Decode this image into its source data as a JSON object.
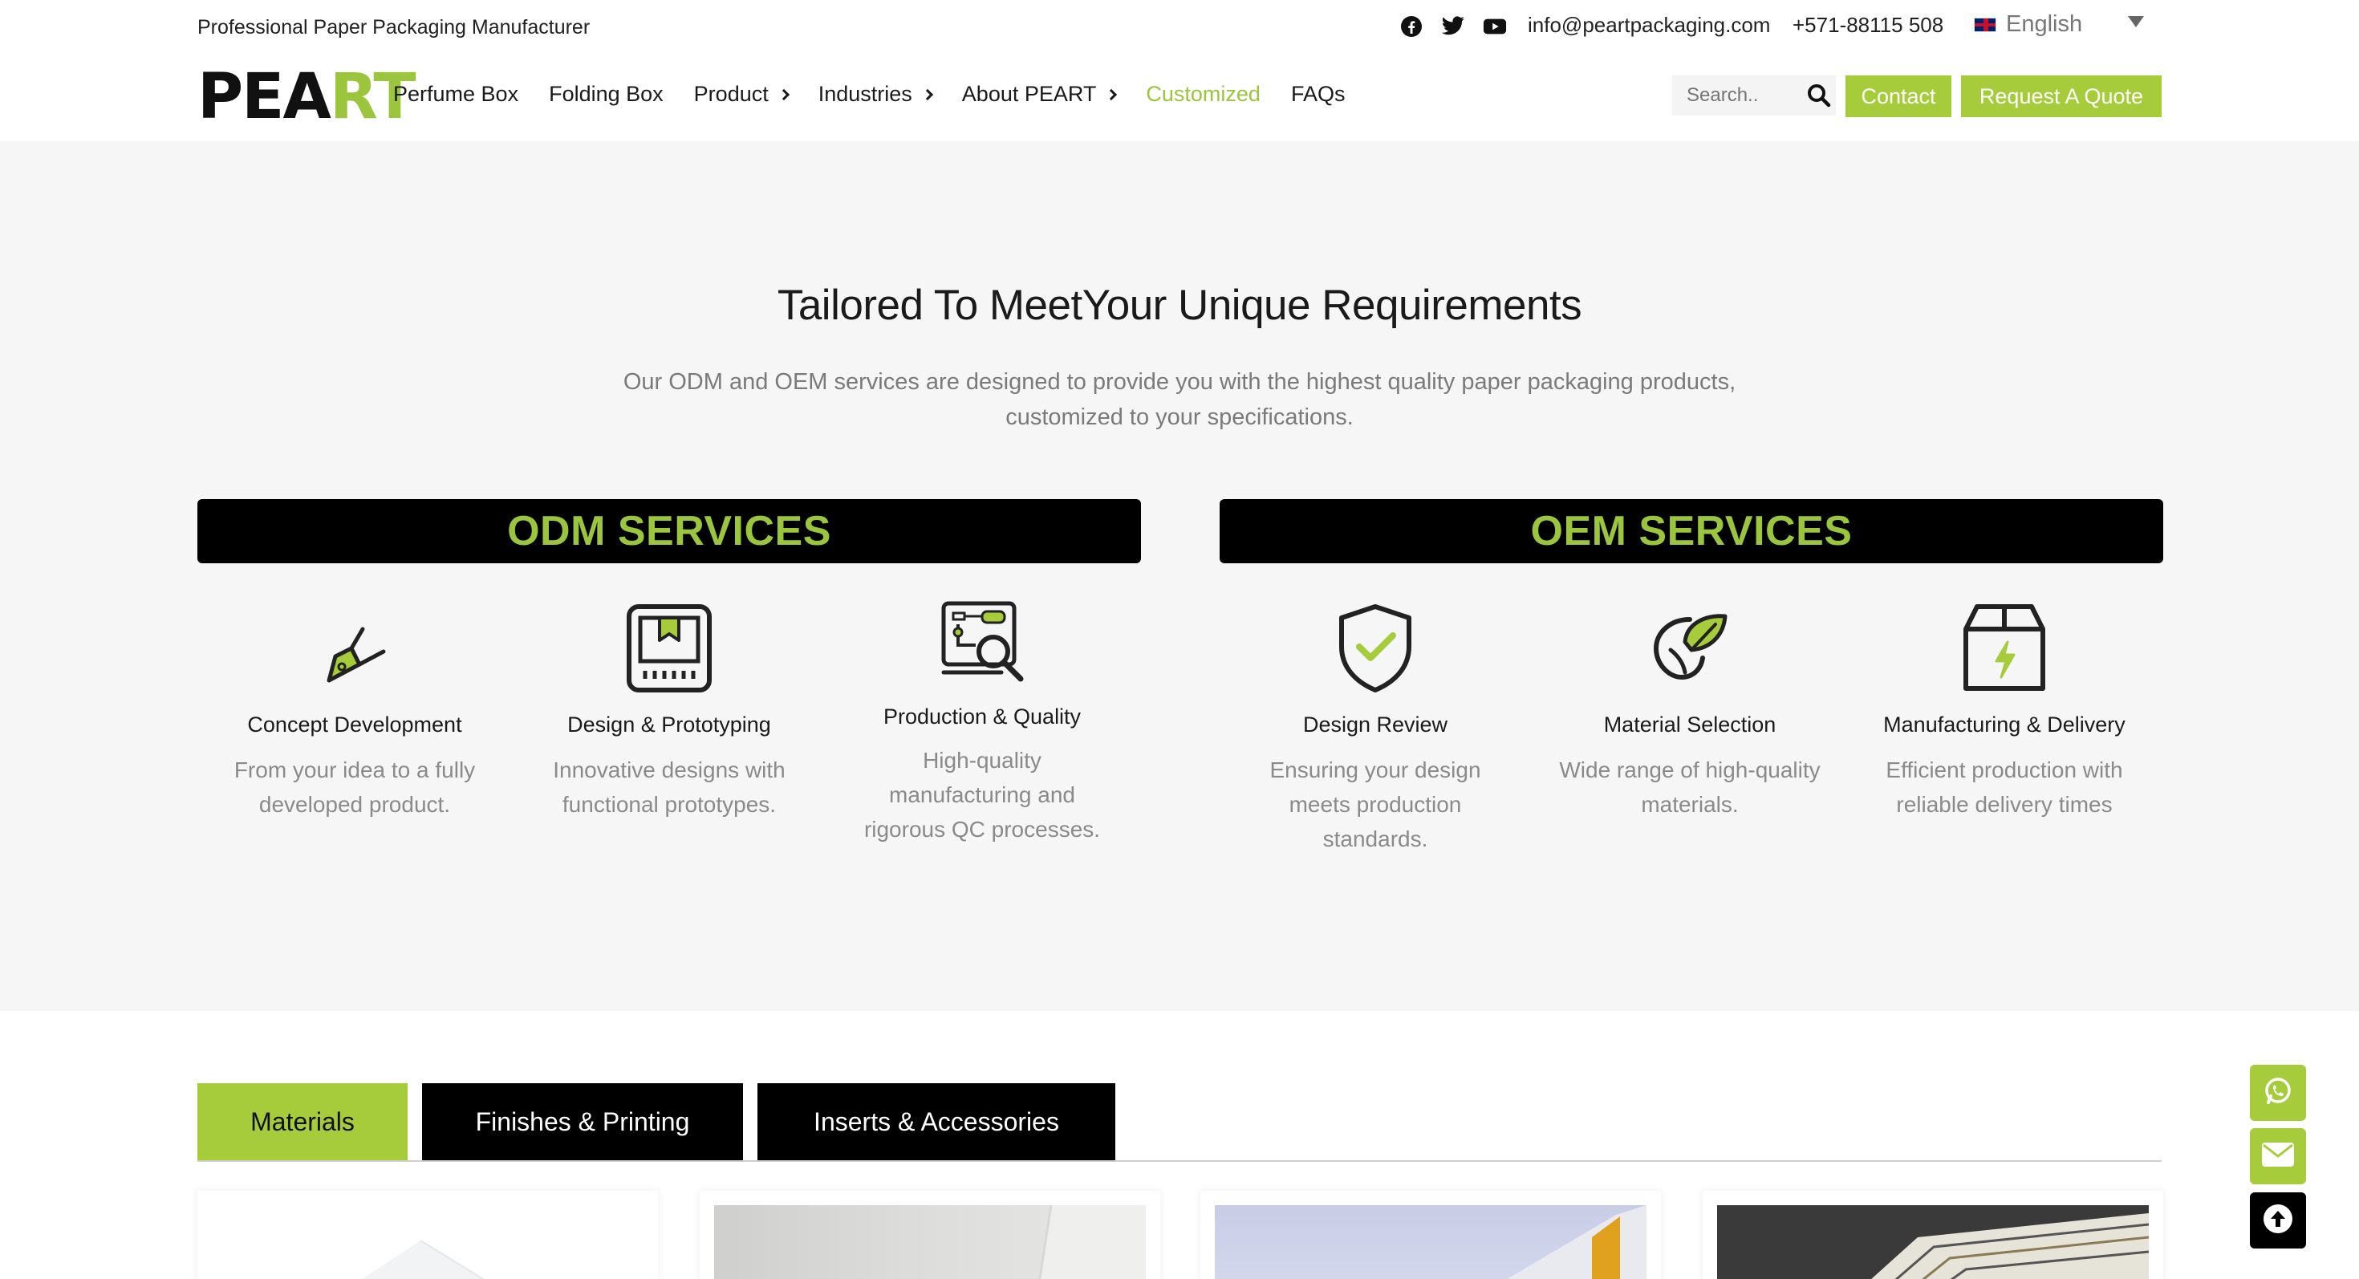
{
  "topbar": {
    "tagline": "Professional Paper Packaging Manufacturer",
    "social_icons": [
      "facebook-icon",
      "twitter-icon",
      "youtube-icon"
    ],
    "email": "info@peartpackaging.com",
    "phone": "+571-88115 508",
    "language": "English"
  },
  "logo": {
    "part1": "PEA",
    "part2": "RT"
  },
  "nav": {
    "items": [
      {
        "label": "Perfume Box",
        "has_submenu": false
      },
      {
        "label": "Folding Box",
        "has_submenu": false
      },
      {
        "label": "Product",
        "has_submenu": true
      },
      {
        "label": "Industries",
        "has_submenu": true
      },
      {
        "label": "About PEART",
        "has_submenu": true
      },
      {
        "label": "Customized",
        "has_submenu": false,
        "active": true
      },
      {
        "label": "FAQs",
        "has_submenu": false
      }
    ],
    "search_placeholder": "Search..",
    "contact_label": "Contact",
    "quote_label": "Request A Quote"
  },
  "services": {
    "title": "Tailored To MeetYour Unique Requirements",
    "intro_line1": "Our ODM and OEM services are designed to provide you with the highest quality paper packaging products,",
    "intro_line2": "customized to your specifications.",
    "odm_heading": "ODM SERVICES",
    "oem_heading": "OEM SERVICES",
    "odm": [
      {
        "title": "Concept Development",
        "desc1": "From your idea to a fully",
        "desc2": "developed product.",
        "desc3": "",
        "icon": "pen-tool-icon"
      },
      {
        "title": "Design & Prototyping",
        "desc1": "Innovative designs with",
        "desc2": "functional prototypes.",
        "desc3": "",
        "icon": "blueprint-icon"
      },
      {
        "title": "Production & Quality",
        "desc1": "High-quality",
        "desc2": "manufacturing and",
        "desc3": "rigorous QC processes.",
        "icon": "quality-inspection-icon"
      }
    ],
    "oem": [
      {
        "title": "Design Review",
        "desc1": "Ensuring your design",
        "desc2": "meets production",
        "desc3": "standards.",
        "icon": "shield-check-icon"
      },
      {
        "title": "Material Selection",
        "desc1": "Wide range of high-quality",
        "desc2": "materials.",
        "desc3": "",
        "icon": "leaf-icon"
      },
      {
        "title": "Manufacturing & Delivery",
        "desc1": "Efficient production with",
        "desc2": "reliable delivery times",
        "desc3": "",
        "icon": "box-icon"
      }
    ]
  },
  "tabs": [
    {
      "label": "Materials",
      "active": true
    },
    {
      "label": "Finishes & Printing",
      "active": false
    },
    {
      "label": "Inserts & Accessories",
      "active": false
    }
  ],
  "colors": {
    "accent": "#a6cc3c",
    "accent_text": "#9bc53d",
    "dark": "#000000",
    "section_bg": "#f6f6f6"
  },
  "floating": [
    "whatsapp-icon",
    "mail-icon",
    "arrow-up-icon"
  ]
}
